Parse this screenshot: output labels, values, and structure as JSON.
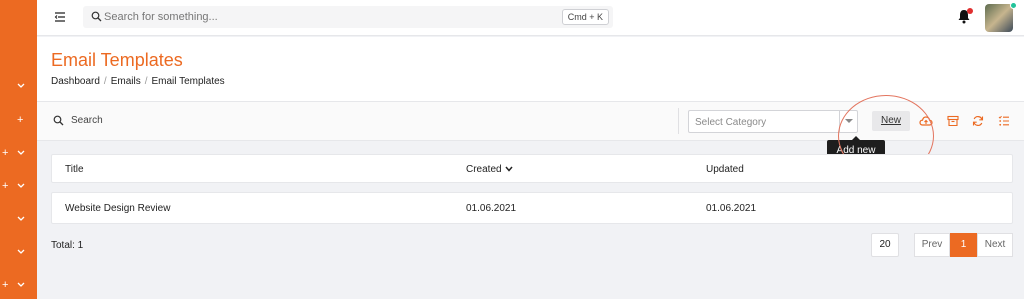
{
  "topbar": {
    "search_placeholder": "Search for something...",
    "shortcut": "Cmd + K"
  },
  "page": {
    "title": "Email Templates",
    "breadcrumb": [
      "Dashboard",
      "Emails",
      "Email Templates"
    ],
    "breadcrumb_sep": "/"
  },
  "toolbar": {
    "search_label": "Search",
    "category_placeholder": "Select Category",
    "new_label": "New",
    "tooltip": "Add new"
  },
  "table": {
    "columns": [
      "Title",
      "Created",
      "Updated"
    ],
    "rows": [
      [
        "Website Design Review",
        "01.06.2021",
        "01.06.2021"
      ]
    ]
  },
  "footer": {
    "total": "Total: 1",
    "per_page": "20",
    "prev_label": "Prev",
    "current_page": "1",
    "next_label": "Next"
  },
  "sidebar": {
    "icons": [
      "chevron-down-icon",
      "plus-icon",
      "plus-chevron",
      "plus-chevron",
      "chevron-down-icon",
      "chevron-down-icon",
      "plus-chevron"
    ]
  },
  "colors": {
    "accent": "#ec6a22",
    "notification": "#e02f2f",
    "online": "#22c39a"
  }
}
